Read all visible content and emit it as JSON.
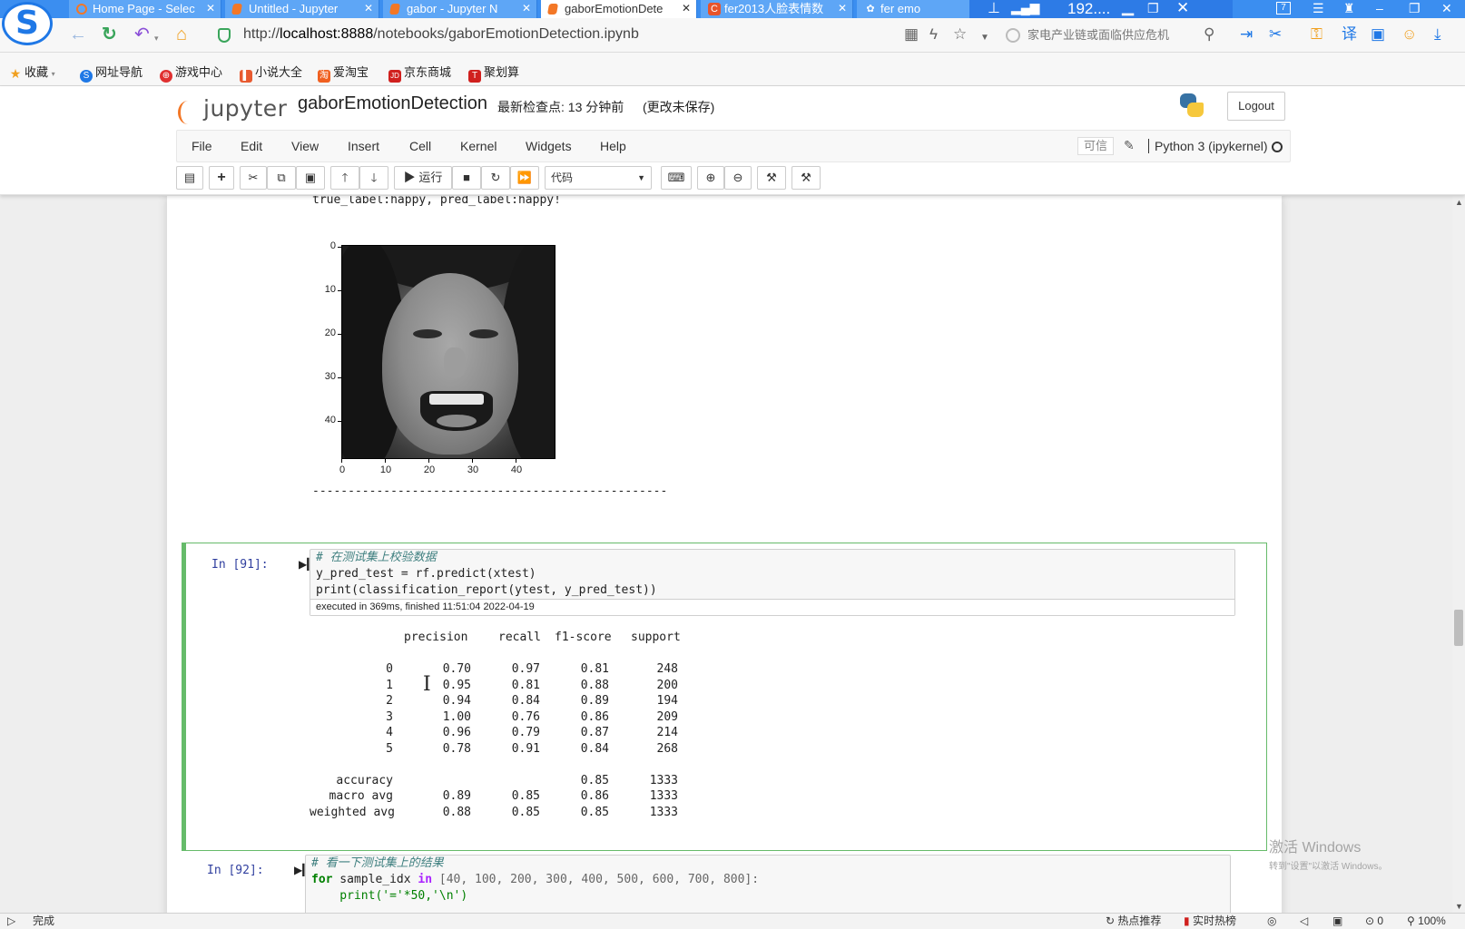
{
  "browser": {
    "tabs": [
      {
        "label": "Home Page - Selec",
        "icon": "jupyter-icon"
      },
      {
        "label": "Untitled - Jupyter",
        "icon": "jupyter-icon"
      },
      {
        "label": "gabor - Jupyter N",
        "icon": "jupyter-icon"
      },
      {
        "label": "gaborEmotionDete",
        "icon": "jupyter-icon"
      },
      {
        "label": "fer2013人脸表情数",
        "icon": "csdn-icon"
      },
      {
        "label": "fer emo",
        "icon": "baidu-icon"
      }
    ],
    "overlay_text": "192....",
    "url_prefix": "http://",
    "url_host": "localhost:8888",
    "url_path": "/notebooks/gaborEmotionDetection.ipynb",
    "search_placeholder": "家电产业链或面临供应危机",
    "bookmarks": [
      "收藏",
      "网址导航",
      "游戏中心",
      "小说大全",
      "爱淘宝",
      "京东商城",
      "聚划算"
    ]
  },
  "jupyter": {
    "logo_text": "jupyter",
    "notebook_name": "gaborEmotionDetection",
    "checkpoint": "最新检查点: 13 分钟前",
    "unsaved": "(更改未保存)",
    "logout": "Logout",
    "menus": [
      "File",
      "Edit",
      "View",
      "Insert",
      "Cell",
      "Kernel",
      "Widgets",
      "Help"
    ],
    "trusted": "可信",
    "kernel": "Python 3 (ipykernel)",
    "run_label": "运行",
    "cell_type": "代码"
  },
  "output_top": {
    "label_line": "true_label:happy, pred_label:happy!",
    "y_ticks": [
      "0",
      "10",
      "20",
      "30",
      "40"
    ],
    "x_ticks": [
      "0",
      "10",
      "20",
      "30",
      "40"
    ],
    "separator": "--------------------------------------------------"
  },
  "cell91": {
    "prompt": "In  [91]:",
    "code": [
      "# 在测试集上校验数据",
      "y_pred_test = rf.predict(xtest)",
      "print(classification_report(ytest, y_pred_test))"
    ],
    "exec_info": "executed in 369ms, finished 11:51:04 2022-04-19",
    "report": {
      "headers": [
        "precision",
        "recall",
        "f1-score",
        "support"
      ],
      "rows": [
        {
          "label": "0",
          "precision": "0.70",
          "recall": "0.97",
          "f1": "0.81",
          "support": "248"
        },
        {
          "label": "1",
          "precision": "0.95",
          "recall": "0.81",
          "f1": "0.88",
          "support": "200"
        },
        {
          "label": "2",
          "precision": "0.94",
          "recall": "0.84",
          "f1": "0.89",
          "support": "194"
        },
        {
          "label": "3",
          "precision": "1.00",
          "recall": "0.76",
          "f1": "0.86",
          "support": "209"
        },
        {
          "label": "4",
          "precision": "0.96",
          "recall": "0.79",
          "f1": "0.87",
          "support": "214"
        },
        {
          "label": "5",
          "precision": "0.78",
          "recall": "0.91",
          "f1": "0.84",
          "support": "268"
        }
      ],
      "summary": [
        {
          "label": "accuracy",
          "precision": "",
          "recall": "",
          "f1": "0.85",
          "support": "1333"
        },
        {
          "label": "macro avg",
          "precision": "0.89",
          "recall": "0.85",
          "f1": "0.86",
          "support": "1333"
        },
        {
          "label": "weighted avg",
          "precision": "0.88",
          "recall": "0.85",
          "f1": "0.85",
          "support": "1333"
        }
      ]
    }
  },
  "cell92": {
    "prompt": "In  [92]:",
    "comment": "# 看一下测试集上的结果",
    "line2_kw": "for",
    "line2_var": " sample_idx ",
    "line2_in": "in",
    "line2_list": " [40, 100, 200, 300, 400, 500, 600, 700, 800]:",
    "line3": "    print('='*50,'\\n')"
  },
  "watermark": {
    "title": "激活 Windows",
    "subtitle": "转到\"设置\"以激活 Windows。"
  },
  "statusbar": {
    "left": "完成",
    "hot": "热点推荐",
    "realtime": "实时热榜",
    "downloads": "0",
    "zoom": "100%"
  },
  "colors": {
    "tab_blue": "#3b8ef0",
    "selected_cell": "#66bb6a",
    "prompt_blue": "#303f9f",
    "jupyter_orange": "#f37726"
  }
}
